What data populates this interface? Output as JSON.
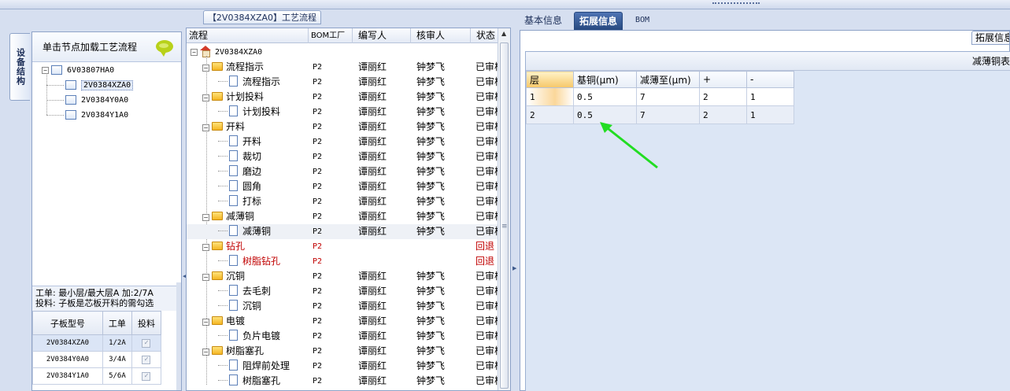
{
  "left": {
    "vtab_label": "设备结构",
    "load_hint": "单击节点加载工艺流程",
    "tree": [
      {
        "label": "6V03807HA0",
        "level": 0,
        "toggle": "−"
      },
      {
        "label": "2V0384XZA0",
        "level": 1,
        "selected": true
      },
      {
        "label": "2V0384Y0A0",
        "level": 1
      },
      {
        "label": "2V0384Y1A0",
        "level": 1
      }
    ],
    "info_line1": "工单: 最小层/最大层A 加:2/7A",
    "info_line2": "投料: 子板是芯板开料的需勾选",
    "sub_table": {
      "headers": [
        "子板型号",
        "工单",
        "投料"
      ],
      "rows": [
        {
          "model": "2V0384XZA0",
          "order": "1/2A",
          "check": "✓"
        },
        {
          "model": "2V0384Y0A0",
          "order": "3/4A",
          "check": "✓"
        },
        {
          "model": "2V0384Y1A0",
          "order": "5/6A",
          "check": "✓"
        }
      ]
    }
  },
  "middle": {
    "title": "【2V0384XZA0】工艺流程",
    "headers": {
      "flow": "流程",
      "bom": "BOM工厂",
      "writer": "编写人",
      "reviewer": "核审人",
      "status": "状态"
    },
    "root": "2V0384XZA0",
    "toggle_minus": "−",
    "rows": [
      {
        "name": "流程指示",
        "type": "folder",
        "bom": "P2",
        "writer": "谭丽红",
        "reviewer": "钟梦飞",
        "status": "已审核"
      },
      {
        "name": "流程指示",
        "type": "doc",
        "bom": "P2",
        "writer": "谭丽红",
        "reviewer": "钟梦飞",
        "status": "已审核"
      },
      {
        "name": "计划投料",
        "type": "folder",
        "bom": "P2",
        "writer": "谭丽红",
        "reviewer": "钟梦飞",
        "status": "已审核"
      },
      {
        "name": "计划投料",
        "type": "doc",
        "bom": "P2",
        "writer": "谭丽红",
        "reviewer": "钟梦飞",
        "status": "已审核"
      },
      {
        "name": "开料",
        "type": "folder",
        "bom": "P2",
        "writer": "谭丽红",
        "reviewer": "钟梦飞",
        "status": "已审核"
      },
      {
        "name": "开料",
        "type": "doc",
        "bom": "P2",
        "writer": "谭丽红",
        "reviewer": "钟梦飞",
        "status": "已审核"
      },
      {
        "name": "裁切",
        "type": "doc",
        "bom": "P2",
        "writer": "谭丽红",
        "reviewer": "钟梦飞",
        "status": "已审核"
      },
      {
        "name": "磨边",
        "type": "doc",
        "bom": "P2",
        "writer": "谭丽红",
        "reviewer": "钟梦飞",
        "status": "已审核"
      },
      {
        "name": "圆角",
        "type": "doc",
        "bom": "P2",
        "writer": "谭丽红",
        "reviewer": "钟梦飞",
        "status": "已审核"
      },
      {
        "name": "打标",
        "type": "doc",
        "bom": "P2",
        "writer": "谭丽红",
        "reviewer": "钟梦飞",
        "status": "已审核"
      },
      {
        "name": "减薄铜",
        "type": "folder",
        "bom": "P2",
        "writer": "谭丽红",
        "reviewer": "钟梦飞",
        "status": "已审核"
      },
      {
        "name": "减薄铜",
        "type": "doc",
        "bom": "P2",
        "writer": "谭丽红",
        "reviewer": "钟梦飞",
        "status": "已审核",
        "selected": true
      },
      {
        "name": "钻孔",
        "type": "folder",
        "bom": "P2",
        "writer": "",
        "reviewer": "",
        "status": "回退",
        "red": true
      },
      {
        "name": "树脂钻孔",
        "type": "doc",
        "bom": "P2",
        "writer": "",
        "reviewer": "",
        "status": "回退",
        "red": true
      },
      {
        "name": "沉铜",
        "type": "folder",
        "bom": "P2",
        "writer": "谭丽红",
        "reviewer": "钟梦飞",
        "status": "已审核"
      },
      {
        "name": "去毛刺",
        "type": "doc",
        "bom": "P2",
        "writer": "谭丽红",
        "reviewer": "钟梦飞",
        "status": "已审核"
      },
      {
        "name": "沉铜",
        "type": "doc",
        "bom": "P2",
        "writer": "谭丽红",
        "reviewer": "钟梦飞",
        "status": "已审核"
      },
      {
        "name": "电镀",
        "type": "folder",
        "bom": "P2",
        "writer": "谭丽红",
        "reviewer": "钟梦飞",
        "status": "已审核"
      },
      {
        "name": "负片电镀",
        "type": "doc",
        "bom": "P2",
        "writer": "谭丽红",
        "reviewer": "钟梦飞",
        "status": "已审核"
      },
      {
        "name": "树脂塞孔",
        "type": "folder",
        "bom": "P2",
        "writer": "谭丽红",
        "reviewer": "钟梦飞",
        "status": "已审核"
      },
      {
        "name": "阻焊前处理",
        "type": "doc",
        "bom": "P2",
        "writer": "谭丽红",
        "reviewer": "钟梦飞",
        "status": "已审核"
      },
      {
        "name": "树脂塞孔",
        "type": "doc",
        "bom": "P2",
        "writer": "谭丽红",
        "reviewer": "钟梦飞",
        "status": "已审核"
      }
    ]
  },
  "right": {
    "tabs": [
      {
        "label": "基本信息",
        "active": false
      },
      {
        "label": "拓展信息",
        "active": true
      },
      {
        "label": "BOM",
        "active": false
      }
    ],
    "ext_tab_label": "拓展信息",
    "caption": "减薄铜表",
    "headers": [
      "层",
      "基铜(μm)",
      "减薄至(μm)",
      "+",
      "-"
    ],
    "rows": [
      [
        "1",
        "0.5",
        "7",
        "2",
        "1"
      ],
      [
        "2",
        "0.5",
        "7",
        "2",
        "1"
      ]
    ],
    "arrow_color": "#22dd22"
  }
}
